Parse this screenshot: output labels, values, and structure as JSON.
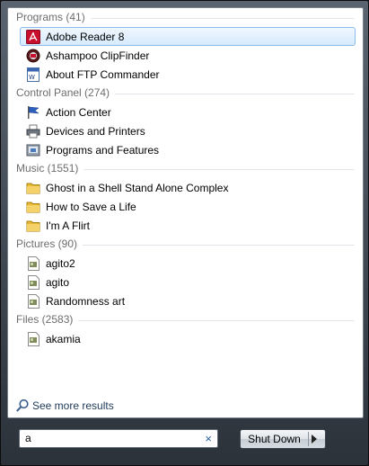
{
  "groups": [
    {
      "header": "Programs (41)",
      "items": [
        {
          "label": "Adobe Reader 8",
          "icon": "adobe-reader-icon",
          "selected": true
        },
        {
          "label": "Ashampoo ClipFinder",
          "icon": "clipfinder-icon"
        },
        {
          "label": "About FTP Commander",
          "icon": "ftp-commander-icon"
        }
      ]
    },
    {
      "header": "Control Panel (274)",
      "items": [
        {
          "label": "Action Center",
          "icon": "flag-icon"
        },
        {
          "label": "Devices and Printers",
          "icon": "printer-icon"
        },
        {
          "label": "Programs and Features",
          "icon": "programs-features-icon"
        }
      ]
    },
    {
      "header": "Music (1551)",
      "items": [
        {
          "label": "Ghost in a Shell Stand Alone Complex",
          "icon": "folder-icon"
        },
        {
          "label": "How to Save a Life",
          "icon": "folder-icon"
        },
        {
          "label": "I'm A Flirt",
          "icon": "folder-icon"
        }
      ]
    },
    {
      "header": "Pictures (90)",
      "items": [
        {
          "label": "agito2",
          "icon": "image-file-icon"
        },
        {
          "label": "agito",
          "icon": "image-file-icon"
        },
        {
          "label": "Randomness art",
          "icon": "image-file-icon"
        }
      ]
    },
    {
      "header": "Files (2583)",
      "items": [
        {
          "label": "akamia",
          "icon": "image-file-icon"
        }
      ]
    }
  ],
  "see_more": "See more results",
  "search": {
    "value": "a",
    "clear_glyph": "×"
  },
  "shutdown": {
    "label": "Shut Down"
  }
}
